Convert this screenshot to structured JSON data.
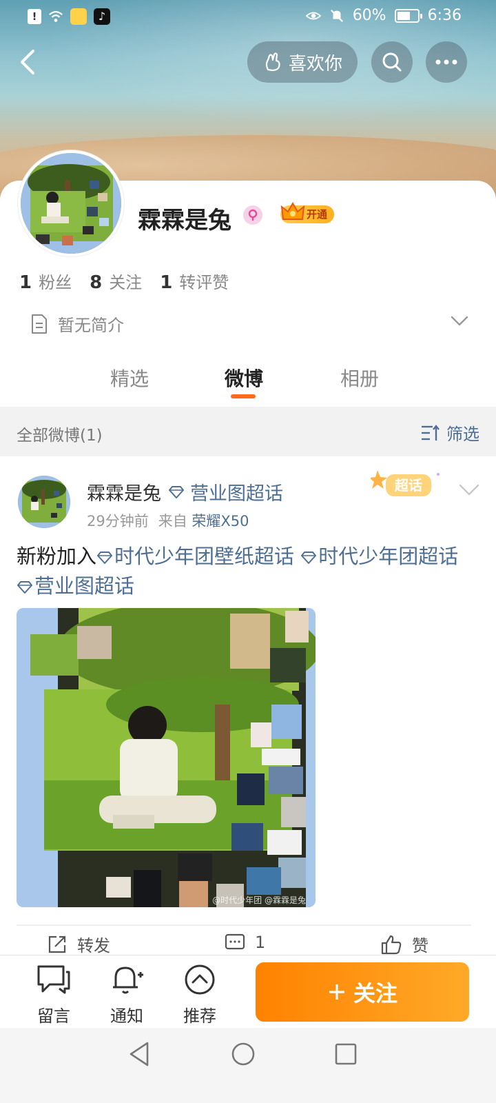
{
  "status": {
    "battery": "60%",
    "time": "6:36"
  },
  "header": {
    "like_label": "喜欢你"
  },
  "profile": {
    "name": "霖霖是兔",
    "vip_label": "开通",
    "stats": [
      {
        "num": "1",
        "label": "粉丝"
      },
      {
        "num": "8",
        "label": "关注"
      },
      {
        "num": "1",
        "label": "转评赞"
      }
    ],
    "bio": "暂无简介"
  },
  "tabs": [
    {
      "label": "精选"
    },
    {
      "label": "微博"
    },
    {
      "label": "相册"
    }
  ],
  "filterbar": {
    "all_label": "全部微博(1)",
    "filter_label": "筛选"
  },
  "post": {
    "author": "霖霖是兔",
    "topic": "营业图超话",
    "time_ago": "29分钟前",
    "source_prefix": "来自",
    "device": "荣耀X50",
    "badge": "超话",
    "text_prefix": "新粉加入",
    "tags": [
      "时代少年团壁纸超话",
      "时代少年团超话",
      "营业图超话"
    ],
    "watermark": "@时代少年团 @霖霖是兔",
    "actions": {
      "repost": "转发",
      "comments": "1",
      "like": "赞"
    }
  },
  "bottombar": {
    "message": "留言",
    "notify": "通知",
    "recommend": "推荐",
    "follow": "关注"
  },
  "colors": {
    "accent": "#ff6a1a",
    "link": "#4e6f93",
    "follow_start": "#ff8200",
    "follow_end": "#ffa928"
  }
}
